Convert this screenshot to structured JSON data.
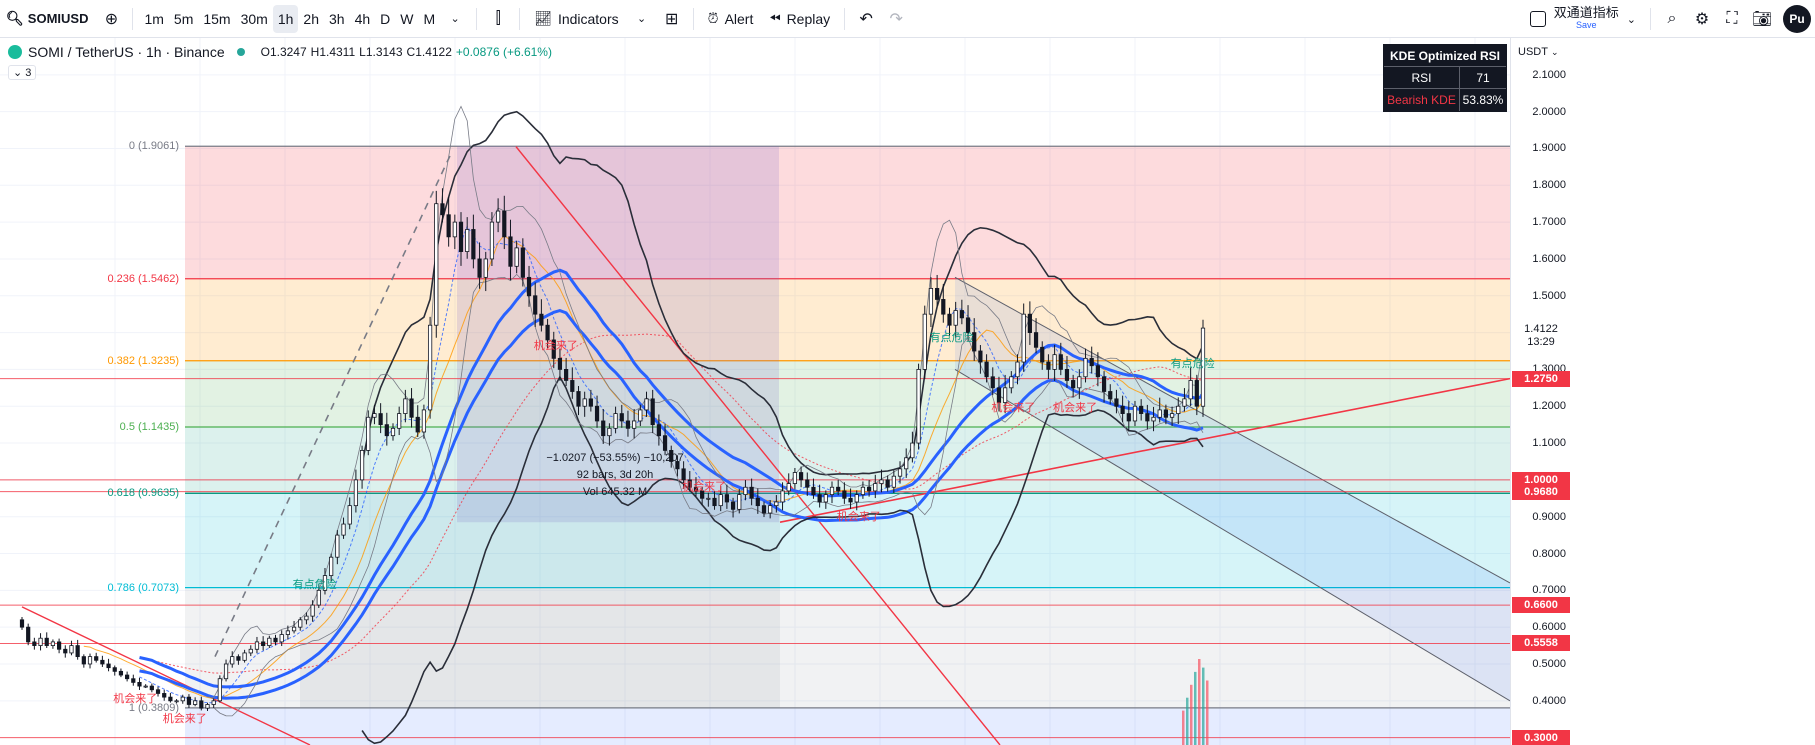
{
  "toolbar": {
    "symbol": "SOMIUSD",
    "timeframes": [
      "1m",
      "5m",
      "15m",
      "30m",
      "1h",
      "2h",
      "3h",
      "4h",
      "D",
      "W",
      "M"
    ],
    "active_timeframe": "1h",
    "indicators_label": "Indicators",
    "alert_label": "Alert",
    "replay_label": "Replay",
    "layout_name": "双通道指标",
    "layout_save": "Save",
    "publish_label": "Pu"
  },
  "legend": {
    "pair": "SOMI / TetherUS · 1h · Binance",
    "open": "O1.3247",
    "high": "H1.4311",
    "low": "L1.3143",
    "close": "C1.4122",
    "change": "+0.0876 (+6.61%)",
    "collapse_count": "3"
  },
  "kde_table": {
    "title": "KDE Optimized RSI",
    "rows": [
      {
        "key": "RSI",
        "value": "71",
        "bear": false
      },
      {
        "key": "Bearish KDE",
        "value": "53.83%",
        "bear": true
      }
    ]
  },
  "price_scale": {
    "currency": "USDT",
    "current_price": "1.4122",
    "countdown": "13:29"
  },
  "colors": {
    "up": "#089981",
    "down": "#f23645",
    "ma_blue": "#2962ff",
    "tag_red": "#f23645"
  },
  "chart_data": {
    "type": "candlestick",
    "ylim": [
      0.28,
      2.2
    ],
    "yticks": [
      2.1,
      2.0,
      1.9,
      1.8,
      1.7,
      1.6,
      1.5,
      1.4,
      1.3,
      1.2,
      1.1,
      1.0,
      0.9,
      0.8,
      0.7,
      0.6,
      0.5,
      0.4
    ],
    "ytick_labels": [
      "2.1000",
      "2.0000",
      "1.9000",
      "1.8000",
      "1.7000",
      "1.6000",
      "1.5000",
      "1.4000",
      "1.3000",
      "1.2000",
      "1.1000",
      "1.0000",
      "0.9000",
      "0.8000",
      "0.7000",
      "0.6000",
      "0.5000",
      "0.4000"
    ],
    "fib_levels": [
      {
        "label": "0 (1.9061)",
        "value": 1.9061,
        "color": "#787b86"
      },
      {
        "label": "0.236 (1.5462)",
        "value": 1.5462,
        "color": "#f23645"
      },
      {
        "label": "0.382 (1.3235)",
        "value": 1.3235,
        "color": "#ff9800"
      },
      {
        "label": "0.5 (1.1435)",
        "value": 1.1435,
        "color": "#4caf50"
      },
      {
        "label": "0.618 (0.9635)",
        "value": 0.9635,
        "color": "#089981"
      },
      {
        "label": "0.786 (0.7073)",
        "value": 0.7073,
        "color": "#00bcd4"
      },
      {
        "label": "1 (0.3809)",
        "value": 0.3809,
        "color": "#787b86"
      }
    ],
    "horizontal_lines": [
      {
        "value": 1.275,
        "label": "1.2750"
      },
      {
        "value": 1.0,
        "label": "1.0000"
      },
      {
        "value": 0.968,
        "label": "0.9680"
      },
      {
        "value": 0.66,
        "label": "0.6600"
      },
      {
        "value": 0.5558,
        "label": "0.5558"
      },
      {
        "value": 0.3,
        "label": "0.3000"
      }
    ],
    "measure": {
      "line1": "−1.0207 (−53.55%) −10,207",
      "line2": "92 bars, 3d 20h",
      "line3": "Vol 645.32 M"
    },
    "signals": [
      {
        "text": "有点危险",
        "price": 0.72,
        "bar": 47,
        "color": "#089981"
      },
      {
        "text": "机会来了",
        "price": 0.41,
        "bar": 18,
        "color": "#f23645"
      },
      {
        "text": "机会来了",
        "price": 0.355,
        "bar": 26,
        "color": "#f23645"
      },
      {
        "text": "机会来了",
        "price": 1.37,
        "bar": 86,
        "color": "#f23645"
      },
      {
        "text": "机会来了",
        "price": 0.985,
        "bar": 110,
        "color": "#f23645"
      },
      {
        "text": "机会来了",
        "price": 0.905,
        "bar": 135,
        "color": "#f23645"
      },
      {
        "text": "有点危险",
        "price": 1.39,
        "bar": 150,
        "color": "#089981"
      },
      {
        "text": "机会来了",
        "price": 1.2,
        "bar": 160,
        "color": "#f23645"
      },
      {
        "text": "机会来了",
        "price": 1.2,
        "bar": 170,
        "color": "#f23645"
      },
      {
        "text": "有点危险",
        "price": 1.32,
        "bar": 189,
        "color": "#089981"
      }
    ],
    "close": [
      0.6,
      0.56,
      0.55,
      0.57,
      0.55,
      0.56,
      0.54,
      0.53,
      0.55,
      0.52,
      0.5,
      0.52,
      0.51,
      0.5,
      0.49,
      0.48,
      0.47,
      0.46,
      0.45,
      0.44,
      0.44,
      0.43,
      0.42,
      0.41,
      0.4,
      0.4,
      0.41,
      0.39,
      0.4,
      0.38,
      0.39,
      0.4,
      0.46,
      0.5,
      0.52,
      0.51,
      0.53,
      0.54,
      0.56,
      0.55,
      0.57,
      0.56,
      0.58,
      0.59,
      0.6,
      0.62,
      0.63,
      0.66,
      0.7,
      0.74,
      0.79,
      0.85,
      0.88,
      0.93,
      1.0,
      1.08,
      1.17,
      1.18,
      1.15,
      1.12,
      1.14,
      1.18,
      1.22,
      1.17,
      1.13,
      1.19,
      1.42,
      1.75,
      1.72,
      1.66,
      1.7,
      1.62,
      1.68,
      1.6,
      1.55,
      1.6,
      1.7,
      1.73,
      1.66,
      1.58,
      1.63,
      1.55,
      1.5,
      1.45,
      1.42,
      1.38,
      1.33,
      1.3,
      1.27,
      1.24,
      1.2,
      1.22,
      1.2,
      1.16,
      1.12,
      1.14,
      1.18,
      1.16,
      1.14,
      1.16,
      1.19,
      1.22,
      1.15,
      1.12,
      1.08,
      1.05,
      1.03,
      1.0,
      0.98,
      0.97,
      0.95,
      0.95,
      0.93,
      0.96,
      0.94,
      0.92,
      0.96,
      0.98,
      0.95,
      0.93,
      0.91,
      0.93,
      0.94,
      0.97,
      0.99,
      1.02,
      1.0,
      0.98,
      0.96,
      0.94,
      0.96,
      0.98,
      0.97,
      0.95,
      0.94,
      0.96,
      0.98,
      0.97,
      0.99,
      1.0,
      0.98,
      1.01,
      1.03,
      1.06,
      1.1,
      1.3,
      1.45,
      1.52,
      1.49,
      1.45,
      1.42,
      1.46,
      1.44,
      1.4,
      1.35,
      1.32,
      1.28,
      1.25,
      1.21,
      1.25,
      1.28,
      1.32,
      1.45,
      1.4,
      1.36,
      1.32,
      1.3,
      1.34,
      1.3,
      1.27,
      1.25,
      1.28,
      1.33,
      1.31,
      1.28,
      1.24,
      1.22,
      1.2,
      1.18,
      1.16,
      1.2,
      1.18,
      1.16,
      1.17,
      1.19,
      1.17,
      1.18,
      1.2,
      1.22,
      1.27,
      1.2,
      1.4122
    ]
  }
}
